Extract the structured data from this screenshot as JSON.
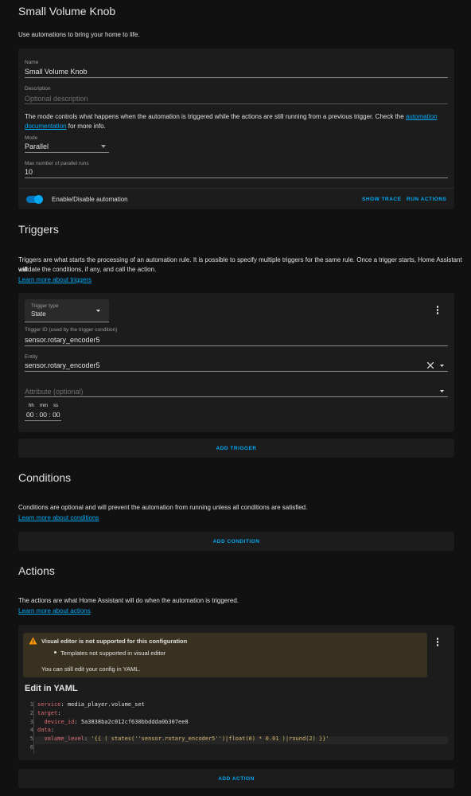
{
  "page": {
    "title": "Small Volume Knob",
    "subtitle": "Use automations to bring your home to life."
  },
  "details": {
    "name_label": "Name",
    "name_value": "Small Volume Knob",
    "description_label": "Description",
    "description_placeholder": "Optional description",
    "mode_text_pre": "The mode controls what happens when the automation is triggered while the actions are still running from a previous trigger. Check the",
    "mode_link": "automation",
    "mode_link2": "documentation",
    "mode_text_post": "for more info.",
    "mode_label": "Mode",
    "mode_value": "Parallel",
    "max_runs_label": "Max number of parallel runs",
    "max_runs_value": "10",
    "toggle_label": "Enable/Disable automation",
    "toggle_on": true,
    "show_trace": "SHOW TRACE",
    "run_actions": "RUN ACTIONS"
  },
  "triggers": {
    "heading": "Triggers",
    "desc_line1": "Triggers are what starts the processing of an automation rule. It is possible to specify multiple triggers for the same rule. Once a trigger starts, Home Assistant will",
    "desc_line2": "validate the conditions, if any, and call the action.",
    "learn_more": "Learn more about triggers",
    "trigger_type_label": "Trigger type",
    "trigger_type_value": "State",
    "trigger_id_label": "Trigger ID (used by the trigger condition)",
    "trigger_id_value": "sensor.rotary_encoder5",
    "entity_label": "Entity",
    "entity_value": "sensor.rotary_encoder5",
    "attribute_placeholder": "Attribute (optional)",
    "dur_hh": "hh",
    "dur_mm": "mm",
    "dur_ss": "ss",
    "duration_value": "00 : 00 : 00",
    "add_button": "ADD TRIGGER"
  },
  "conditions": {
    "heading": "Conditions",
    "desc": "Conditions are optional and will prevent the automation from running unless all conditions are satisfied.",
    "learn_more": "Learn more about conditions",
    "add_button": "ADD CONDITION"
  },
  "actions": {
    "heading": "Actions",
    "desc": "The actions are what Home Assistant will do when the automation is triggered.",
    "learn_more": "Learn more about actions",
    "warning_title": "Visual editor is not supported for this configuration",
    "warning_bullet": "Templates not supported in visual editor",
    "warning_footer": "You can still edit your config in YAML.",
    "yaml_heading": "Edit in YAML",
    "yaml_lines": [
      {
        "num": "1",
        "key": "service",
        "value": "media_player.volume_set",
        "indent": ""
      },
      {
        "num": "2",
        "key": "target",
        "value": "",
        "indent": ""
      },
      {
        "num": "3",
        "key": "device_id",
        "value": "5a3838ba2c012cf630bbddda0b307ee8",
        "indent": "  "
      },
      {
        "num": "4",
        "key": "data",
        "value": "",
        "indent": ""
      },
      {
        "num": "5",
        "key": "volume_level",
        "value": "'{{ ( states(''sensor.rotary_encoder5'')|float(0) * 0.01 )|round(2) }}'",
        "indent": "  "
      },
      {
        "num": "6",
        "key": "",
        "value": "",
        "indent": ""
      }
    ],
    "add_button": "ADD ACTION"
  },
  "colors": {
    "accent": "#03a9f4",
    "warning": "#ff9800",
    "background": "#111111",
    "card": "#1c1c1c"
  },
  "icons": {
    "dropdown": "chevron-down-icon",
    "clear": "close-icon",
    "menu": "more-vertical-icon",
    "warning": "alert-triangle-icon"
  }
}
